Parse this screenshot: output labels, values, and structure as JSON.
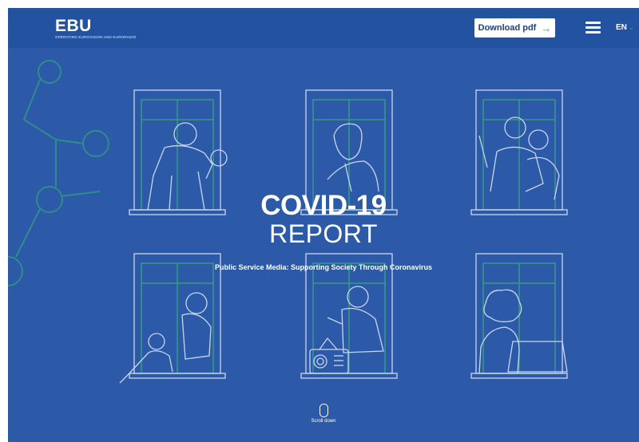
{
  "header": {
    "logo_text": "EBU",
    "logo_tagline": "OPERATING EUROVISION AND EURORADIO",
    "download_label": "Download pdf",
    "download_icon": "arrow-right-icon",
    "menu_icon": "hamburger-menu-icon",
    "language": "EN",
    "language_icon": "chevron-down-icon"
  },
  "hero": {
    "title_line1": "COVID-19",
    "title_line2": "REPORT",
    "subtitle": "Public Service Media: Supporting Society Through Coronavirus"
  },
  "scroll": {
    "icon": "mouse-scroll-icon",
    "label": "Scroll down"
  },
  "colors": {
    "background": "#2c5aa8",
    "header": "#2352a0",
    "line_art": "#c8d6ee",
    "accent_green": "#3aa37f"
  }
}
